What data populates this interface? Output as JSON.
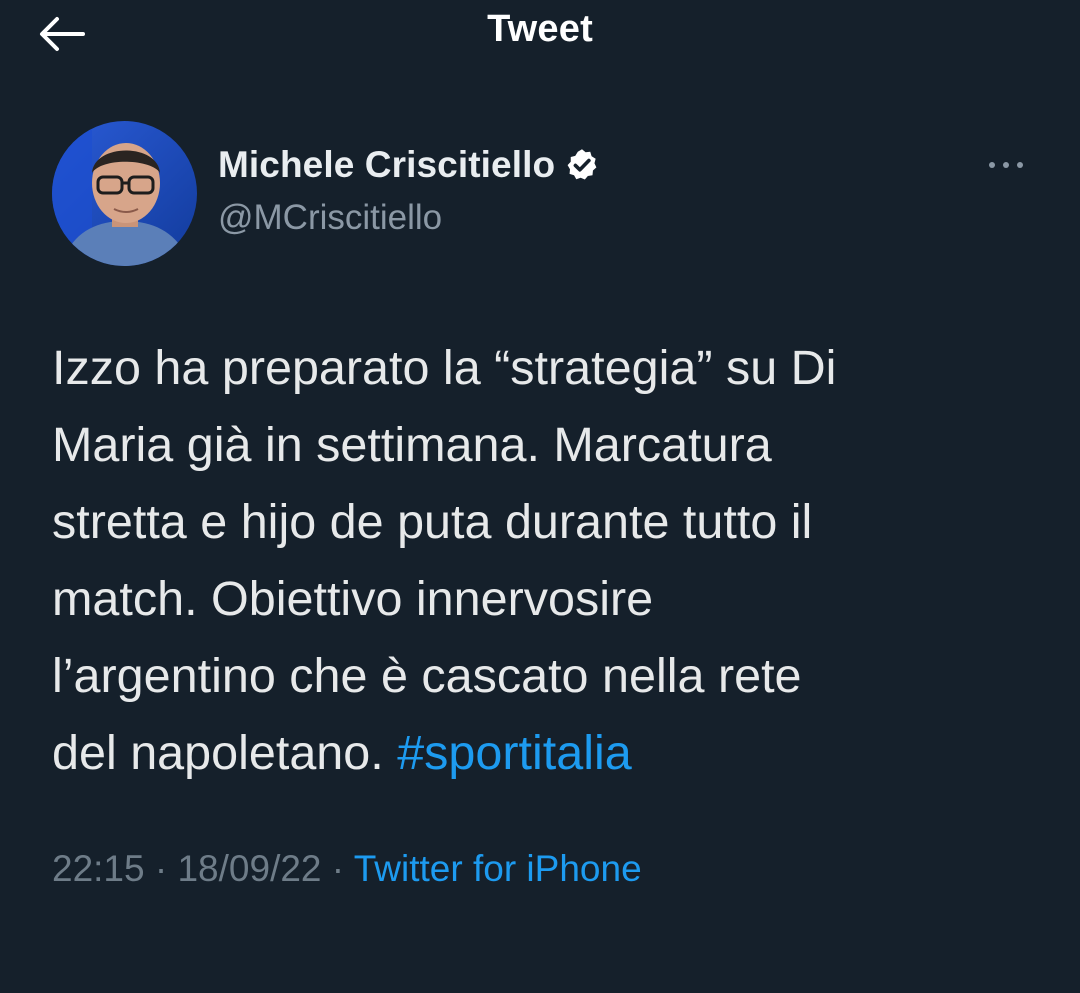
{
  "header": {
    "back_icon": "arrow-left-icon",
    "title": "Tweet"
  },
  "author": {
    "display_name": "Michele Criscitiello",
    "handle": "@MCriscitiello",
    "verified_icon": "verified-badge-icon",
    "avatar_icon": "avatar"
  },
  "more_icon": "more-horizontal-icon",
  "tweet": {
    "text": "Izzo ha preparato la “strategia” su Di\nMaria già in settimana. Marcatura\nstretta e hijo de puta durante tutto il\nmatch. Obiettivo innervosire\nl’argentino che è cascato nella rete\ndel napoletano. ",
    "hashtag": "#sportitalia"
  },
  "meta": {
    "time": "22:15",
    "separator": " · ",
    "date": "18/09/22",
    "source": "Twitter for iPhone"
  },
  "colors": {
    "background": "#15202b",
    "accent": "#1d9bf0",
    "secondary_text": "#8b98a5"
  }
}
